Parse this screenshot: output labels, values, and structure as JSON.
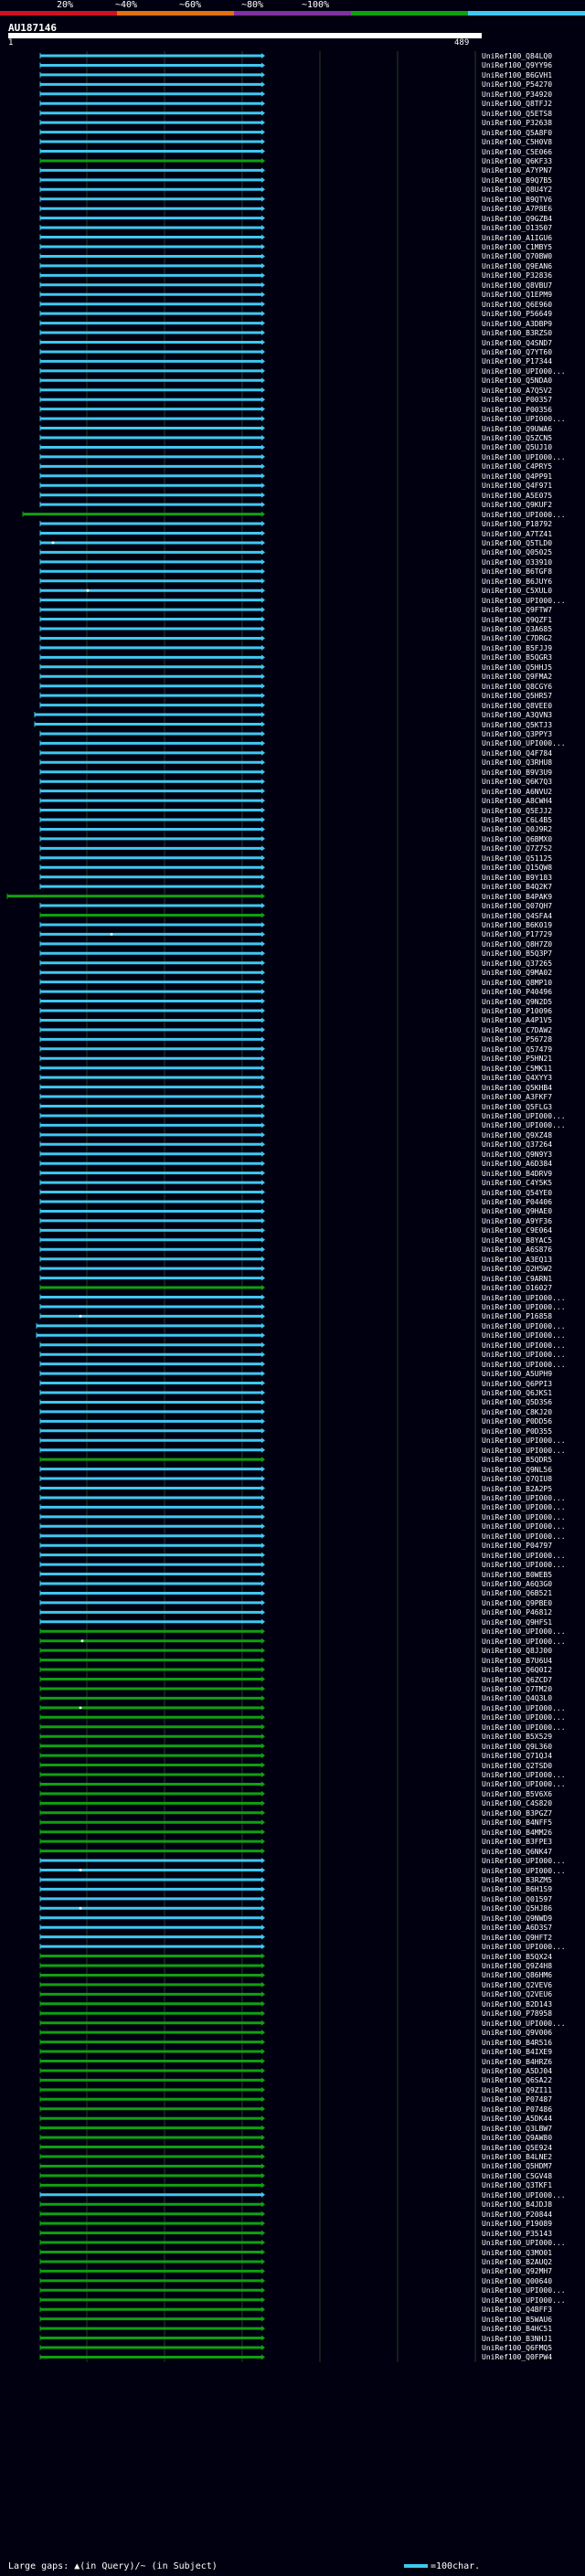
{
  "scale": {
    "segments": [
      {
        "color": "#d01020"
      },
      {
        "color": "#e07010"
      },
      {
        "color": "#8030a0"
      },
      {
        "color": "#10a010"
      },
      {
        "color": "#40c8f0"
      }
    ],
    "labels": [
      "20%",
      "~40%",
      "~60%",
      "~80%",
      "~100%"
    ]
  },
  "query": {
    "id": "AU187146",
    "start": "1",
    "end": "489"
  },
  "colors": {
    "cyan": "#40c8f0",
    "green": "#10a010",
    "grid": "#2a3a2a",
    "gap": "#ffffff"
  },
  "hits": [
    {
      "id": "UniRef100_Q84LQ0",
      "c": "cyan"
    },
    {
      "id": "UniRef100_Q9YY96",
      "c": "cyan"
    },
    {
      "id": "UniRef100_B6GVH1",
      "c": "cyan"
    },
    {
      "id": "UniRef100_P54270",
      "c": "cyan"
    },
    {
      "id": "UniRef100_P34920",
      "c": "cyan"
    },
    {
      "id": "UniRef100_Q8TFJ2",
      "c": "cyan"
    },
    {
      "id": "UniRef100_Q5ETS8",
      "c": "cyan"
    },
    {
      "id": "UniRef100_P32638",
      "c": "cyan"
    },
    {
      "id": "UniRef100_Q5A8F0",
      "c": "cyan"
    },
    {
      "id": "UniRef100_C5H0V8",
      "c": "cyan"
    },
    {
      "id": "UniRef100_C5E066",
      "c": "cyan"
    },
    {
      "id": "UniRef100_Q6KF33",
      "c": "green"
    },
    {
      "id": "UniRef100_A7YPN7",
      "c": "cyan"
    },
    {
      "id": "UniRef100_B9Q7B5",
      "c": "cyan"
    },
    {
      "id": "UniRef100_Q8U4Y2",
      "c": "cyan"
    },
    {
      "id": "UniRef100_B9QTV6",
      "c": "cyan"
    },
    {
      "id": "UniRef100_A7P8E6",
      "c": "cyan"
    },
    {
      "id": "UniRef100_Q9GZB4",
      "c": "cyan"
    },
    {
      "id": "UniRef100_O13507",
      "c": "cyan"
    },
    {
      "id": "UniRef100_A1IGU6",
      "c": "cyan"
    },
    {
      "id": "UniRef100_C1MBY5",
      "c": "cyan"
    },
    {
      "id": "UniRef100_Q70BW0",
      "c": "cyan"
    },
    {
      "id": "UniRef100_Q9EAN6",
      "c": "cyan"
    },
    {
      "id": "UniRef100_P32836",
      "c": "cyan"
    },
    {
      "id": "UniRef100_Q8VBU7",
      "c": "cyan"
    },
    {
      "id": "UniRef100_Q1EPM9",
      "c": "cyan"
    },
    {
      "id": "UniRef100_Q6E960",
      "c": "cyan"
    },
    {
      "id": "UniRef100_P56649",
      "c": "cyan"
    },
    {
      "id": "UniRef100_A3DBP9",
      "c": "cyan"
    },
    {
      "id": "UniRef100_B3RZS0",
      "c": "cyan"
    },
    {
      "id": "UniRef100_Q4SND7",
      "c": "cyan"
    },
    {
      "id": "UniRef100_Q7YT60",
      "c": "cyan"
    },
    {
      "id": "UniRef100_P17344",
      "c": "cyan"
    },
    {
      "id": "UniRef100_UPI000...",
      "c": "cyan"
    },
    {
      "id": "UniRef100_Q5NDA0",
      "c": "cyan"
    },
    {
      "id": "UniRef100_A7Q5V2",
      "c": "cyan"
    },
    {
      "id": "UniRef100_P00357",
      "c": "cyan"
    },
    {
      "id": "UniRef100_P00356",
      "c": "cyan"
    },
    {
      "id": "UniRef100_UPI000...",
      "c": "cyan"
    },
    {
      "id": "UniRef100_Q9UWA6",
      "c": "cyan"
    },
    {
      "id": "UniRef100_Q5ZCN5",
      "c": "cyan"
    },
    {
      "id": "UniRef100_Q5UJ10",
      "c": "cyan"
    },
    {
      "id": "UniRef100_UPI000...",
      "c": "cyan"
    },
    {
      "id": "UniRef100_C4PRY5",
      "c": "cyan"
    },
    {
      "id": "UniRef100_Q4PP91",
      "c": "cyan"
    },
    {
      "id": "UniRef100_Q4F971",
      "c": "cyan"
    },
    {
      "id": "UniRef100_A5E075",
      "c": "cyan"
    },
    {
      "id": "UniRef100_Q9KUF2",
      "c": "cyan"
    },
    {
      "id": "UniRef100_UPI000...",
      "c": "green"
    },
    {
      "id": "UniRef100_P18792",
      "c": "cyan"
    },
    {
      "id": "UniRef100_A7TZ41",
      "c": "cyan"
    },
    {
      "id": "UniRef100_Q5TLD0",
      "c": "cyan"
    },
    {
      "id": "UniRef100_Q05025",
      "c": "cyan"
    },
    {
      "id": "UniRef100_O33910",
      "c": "cyan"
    },
    {
      "id": "UniRef100_B6TGF8",
      "c": "cyan"
    },
    {
      "id": "UniRef100_B6JUY6",
      "c": "cyan"
    },
    {
      "id": "UniRef100_C5XUL0",
      "c": "cyan"
    },
    {
      "id": "UniRef100_UPI000...",
      "c": "cyan"
    },
    {
      "id": "UniRef100_Q9FTW7",
      "c": "cyan"
    },
    {
      "id": "UniRef100_Q9QZF1",
      "c": "cyan"
    },
    {
      "id": "UniRef100_Q3A685",
      "c": "cyan"
    },
    {
      "id": "UniRef100_C7DRG2",
      "c": "cyan"
    },
    {
      "id": "UniRef100_B5FJJ9",
      "c": "cyan"
    },
    {
      "id": "UniRef100_B5QGR3",
      "c": "cyan"
    },
    {
      "id": "UniRef100_Q5HHJ5",
      "c": "cyan"
    },
    {
      "id": "UniRef100_Q9FMA2",
      "c": "cyan"
    },
    {
      "id": "UniRef100_Q8CGY6",
      "c": "cyan"
    },
    {
      "id": "UniRef100_Q5HR57",
      "c": "cyan"
    },
    {
      "id": "UniRef100_Q8VEE0",
      "c": "cyan"
    },
    {
      "id": "UniRef100_A3QVN3",
      "c": "cyan"
    },
    {
      "id": "UniRef100_Q5KTJ3",
      "c": "cyan"
    },
    {
      "id": "UniRef100_Q3PPY3",
      "c": "cyan"
    },
    {
      "id": "UniRef100_UPI000...",
      "c": "cyan"
    },
    {
      "id": "UniRef100_Q4F784",
      "c": "cyan"
    },
    {
      "id": "UniRef100_Q3RHU8",
      "c": "cyan"
    },
    {
      "id": "UniRef100_B9V3U9",
      "c": "cyan"
    },
    {
      "id": "UniRef100_Q6K7Q3",
      "c": "cyan"
    },
    {
      "id": "UniRef100_A6NVU2",
      "c": "cyan"
    },
    {
      "id": "UniRef100_A8CWH4",
      "c": "cyan"
    },
    {
      "id": "UniRef100_Q5EJJ2",
      "c": "cyan"
    },
    {
      "id": "UniRef100_C6L4B5",
      "c": "cyan"
    },
    {
      "id": "UniRef100_Q0J9R2",
      "c": "cyan"
    },
    {
      "id": "UniRef100_Q6BMX0",
      "c": "cyan"
    },
    {
      "id": "UniRef100_Q7Z7S2",
      "c": "cyan"
    },
    {
      "id": "UniRef100_Q51125",
      "c": "cyan"
    },
    {
      "id": "UniRef100_Q15QW8",
      "c": "cyan"
    },
    {
      "id": "UniRef100_B9Y183",
      "c": "cyan"
    },
    {
      "id": "UniRef100_B4Q2K7",
      "c": "cyan"
    },
    {
      "id": "UniRef100_B4PAK9",
      "c": "green"
    },
    {
      "id": "UniRef100_Q07QH7",
      "c": "cyan"
    },
    {
      "id": "UniRef100_Q4SFA4",
      "c": "green"
    },
    {
      "id": "UniRef100_B6K019",
      "c": "cyan"
    },
    {
      "id": "UniRef100_P17729",
      "c": "cyan"
    },
    {
      "id": "UniRef100_Q8H7Z0",
      "c": "cyan"
    },
    {
      "id": "UniRef100_B5Q3P7",
      "c": "cyan"
    },
    {
      "id": "UniRef100_Q37265",
      "c": "cyan"
    },
    {
      "id": "UniRef100_Q9MA02",
      "c": "cyan"
    },
    {
      "id": "UniRef100_Q8MP10",
      "c": "cyan"
    },
    {
      "id": "UniRef100_P40496",
      "c": "cyan"
    },
    {
      "id": "UniRef100_Q9N2D5",
      "c": "cyan"
    },
    {
      "id": "UniRef100_P10096",
      "c": "cyan"
    },
    {
      "id": "UniRef100_A4P1V5",
      "c": "cyan"
    },
    {
      "id": "UniRef100_C7DAW2",
      "c": "cyan"
    },
    {
      "id": "UniRef100_P56728",
      "c": "cyan"
    },
    {
      "id": "UniRef100_Q57479",
      "c": "cyan"
    },
    {
      "id": "UniRef100_P5HN21",
      "c": "cyan"
    },
    {
      "id": "UniRef100_C5MK11",
      "c": "cyan"
    },
    {
      "id": "UniRef100_Q4XYY3",
      "c": "cyan"
    },
    {
      "id": "UniRef100_Q5KHB4",
      "c": "cyan"
    },
    {
      "id": "UniRef100_A3FKF7",
      "c": "cyan"
    },
    {
      "id": "UniRef100_Q5FLG3",
      "c": "cyan"
    },
    {
      "id": "UniRef100_UPI000...",
      "c": "cyan"
    },
    {
      "id": "UniRef100_UPI000...",
      "c": "cyan"
    },
    {
      "id": "UniRef100_Q9XZ48",
      "c": "cyan"
    },
    {
      "id": "UniRef100_Q37264",
      "c": "cyan"
    },
    {
      "id": "UniRef100_Q9N9Y3",
      "c": "cyan"
    },
    {
      "id": "UniRef100_A6D384",
      "c": "cyan"
    },
    {
      "id": "UniRef100_B4DRV9",
      "c": "cyan"
    },
    {
      "id": "UniRef100_C4Y5K5",
      "c": "cyan"
    },
    {
      "id": "UniRef100_Q54YE0",
      "c": "cyan"
    },
    {
      "id": "UniRef100_P04406",
      "c": "cyan"
    },
    {
      "id": "UniRef100_Q9HAE0",
      "c": "cyan"
    },
    {
      "id": "UniRef100_A9YF36",
      "c": "cyan"
    },
    {
      "id": "UniRef100_C9E064",
      "c": "cyan"
    },
    {
      "id": "UniRef100_B8YAC5",
      "c": "cyan"
    },
    {
      "id": "UniRef100_A6S876",
      "c": "cyan"
    },
    {
      "id": "UniRef100_A3EQ13",
      "c": "cyan"
    },
    {
      "id": "UniRef100_Q2H5W2",
      "c": "cyan"
    },
    {
      "id": "UniRef100_C9ARN1",
      "c": "cyan"
    },
    {
      "id": "UniRef100_O16027",
      "c": "green"
    },
    {
      "id": "UniRef100_UPI000...",
      "c": "cyan"
    },
    {
      "id": "UniRef100_UPI000...",
      "c": "cyan"
    },
    {
      "id": "UniRef100_P16858",
      "c": "cyan"
    },
    {
      "id": "UniRef100_UPI000...",
      "c": "cyan"
    },
    {
      "id": "UniRef100_UPI000...",
      "c": "cyan"
    },
    {
      "id": "UniRef100_UPI000...",
      "c": "cyan"
    },
    {
      "id": "UniRef100_UPI000...",
      "c": "cyan"
    },
    {
      "id": "UniRef100_UPI000...",
      "c": "cyan"
    },
    {
      "id": "UniRef100_A5UPH9",
      "c": "cyan"
    },
    {
      "id": "UniRef100_Q6PPI3",
      "c": "cyan"
    },
    {
      "id": "UniRef100_Q6JKS1",
      "c": "cyan"
    },
    {
      "id": "UniRef100_Q5D3S6",
      "c": "cyan"
    },
    {
      "id": "UniRef100_C8KJ20",
      "c": "cyan"
    },
    {
      "id": "UniRef100_P0DD56",
      "c": "cyan"
    },
    {
      "id": "UniRef100_P0D355",
      "c": "cyan"
    },
    {
      "id": "UniRef100_UPI000...",
      "c": "cyan"
    },
    {
      "id": "UniRef100_UPI000...",
      "c": "cyan"
    },
    {
      "id": "UniRef100_B5QDR5",
      "c": "green"
    },
    {
      "id": "UniRef100_Q9NL56",
      "c": "cyan"
    },
    {
      "id": "UniRef100_Q7QIU8",
      "c": "cyan"
    },
    {
      "id": "UniRef100_B2A2P5",
      "c": "cyan"
    },
    {
      "id": "UniRef100_UPI000...",
      "c": "cyan"
    },
    {
      "id": "UniRef100_UPI000...",
      "c": "cyan"
    },
    {
      "id": "UniRef100_UPI000...",
      "c": "cyan"
    },
    {
      "id": "UniRef100_UPI000...",
      "c": "cyan"
    },
    {
      "id": "UniRef100_UPI000...",
      "c": "cyan"
    },
    {
      "id": "UniRef100_P04797",
      "c": "cyan"
    },
    {
      "id": "UniRef100_UPI000...",
      "c": "cyan"
    },
    {
      "id": "UniRef100_UPI000...",
      "c": "cyan"
    },
    {
      "id": "UniRef100_B0WEB5",
      "c": "cyan"
    },
    {
      "id": "UniRef100_A6Q3G0",
      "c": "cyan"
    },
    {
      "id": "UniRef100_Q6B521",
      "c": "cyan"
    },
    {
      "id": "UniRef100_Q9PBE0",
      "c": "cyan"
    },
    {
      "id": "UniRef100_P46812",
      "c": "cyan"
    },
    {
      "id": "UniRef100_Q9HFS1",
      "c": "cyan"
    },
    {
      "id": "UniRef100_UPI000...",
      "c": "green"
    },
    {
      "id": "UniRef100_UPI000...",
      "c": "green"
    },
    {
      "id": "UniRef100_Q8JJ00",
      "c": "green"
    },
    {
      "id": "UniRef100_B7U6U4",
      "c": "green"
    },
    {
      "id": "UniRef100_Q6Q0I2",
      "c": "green"
    },
    {
      "id": "UniRef100_Q6ZCD7",
      "c": "green"
    },
    {
      "id": "UniRef100_Q7TM20",
      "c": "green"
    },
    {
      "id": "UniRef100_Q4Q3L0",
      "c": "green"
    },
    {
      "id": "UniRef100_UPI000...",
      "c": "green"
    },
    {
      "id": "UniRef100_UPI000...",
      "c": "green"
    },
    {
      "id": "UniRef100_UPI000...",
      "c": "green"
    },
    {
      "id": "UniRef100_B5X529",
      "c": "green"
    },
    {
      "id": "UniRef100_Q9L360",
      "c": "green"
    },
    {
      "id": "UniRef100_Q71QJ4",
      "c": "green"
    },
    {
      "id": "UniRef100_Q2TSD0",
      "c": "green"
    },
    {
      "id": "UniRef100_UPI000...",
      "c": "green"
    },
    {
      "id": "UniRef100_UPI000...",
      "c": "green"
    },
    {
      "id": "UniRef100_B5V6X6",
      "c": "green"
    },
    {
      "id": "UniRef100_C4S820",
      "c": "green"
    },
    {
      "id": "UniRef100_B3PGZ7",
      "c": "green"
    },
    {
      "id": "UniRef100_B4NFF5",
      "c": "green"
    },
    {
      "id": "UniRef100_B4MM26",
      "c": "green"
    },
    {
      "id": "UniRef100_B3FPE3",
      "c": "green"
    },
    {
      "id": "UniRef100_Q6NK47",
      "c": "green"
    },
    {
      "id": "UniRef100_UPI000...",
      "c": "cyan"
    },
    {
      "id": "UniRef100_UPI000...",
      "c": "cyan"
    },
    {
      "id": "UniRef100_B3RZM5",
      "c": "cyan"
    },
    {
      "id": "UniRef100_B6H1S9",
      "c": "cyan"
    },
    {
      "id": "UniRef100_Q01597",
      "c": "cyan"
    },
    {
      "id": "UniRef100_Q5HJ86",
      "c": "cyan"
    },
    {
      "id": "UniRef100_Q9NWD9",
      "c": "cyan"
    },
    {
      "id": "UniRef100_A6D3S7",
      "c": "cyan"
    },
    {
      "id": "UniRef100_Q9HFT2",
      "c": "cyan"
    },
    {
      "id": "UniRef100_UPI000...",
      "c": "cyan"
    },
    {
      "id": "UniRef100_B5QX24",
      "c": "green"
    },
    {
      "id": "UniRef100_Q9Z4H8",
      "c": "green"
    },
    {
      "id": "UniRef100_Q86HM6",
      "c": "green"
    },
    {
      "id": "UniRef100_Q2VEV6",
      "c": "green"
    },
    {
      "id": "UniRef100_Q2VEU6",
      "c": "green"
    },
    {
      "id": "UniRef100_B2D143",
      "c": "green"
    },
    {
      "id": "UniRef100_P78958",
      "c": "green"
    },
    {
      "id": "UniRef100_UPI000...",
      "c": "green"
    },
    {
      "id": "UniRef100_Q9V006",
      "c": "green"
    },
    {
      "id": "UniRef100_B4R516",
      "c": "green"
    },
    {
      "id": "UniRef100_B4IXE9",
      "c": "green"
    },
    {
      "id": "UniRef100_B4HRZ6",
      "c": "green"
    },
    {
      "id": "UniRef100_A5DJ04",
      "c": "green"
    },
    {
      "id": "UniRef100_Q6SA22",
      "c": "green"
    },
    {
      "id": "UniRef100_Q9ZI11",
      "c": "green"
    },
    {
      "id": "UniRef100_P07487",
      "c": "green"
    },
    {
      "id": "UniRef100_P07486",
      "c": "green"
    },
    {
      "id": "UniRef100_A5DK44",
      "c": "green"
    },
    {
      "id": "UniRef100_Q3LBW7",
      "c": "green"
    },
    {
      "id": "UniRef100_Q9AW80",
      "c": "green"
    },
    {
      "id": "UniRef100_Q5E924",
      "c": "green"
    },
    {
      "id": "UniRef100_B4LNE2",
      "c": "green"
    },
    {
      "id": "UniRef100_Q5HDM7",
      "c": "green"
    },
    {
      "id": "UniRef100_C5GV48",
      "c": "green"
    },
    {
      "id": "UniRef100_Q3TKF1",
      "c": "green"
    },
    {
      "id": "UniRef100_UPI000...",
      "c": "cyan"
    },
    {
      "id": "UniRef100_B4JDJ8",
      "c": "green"
    },
    {
      "id": "UniRef100_P20844",
      "c": "green"
    },
    {
      "id": "UniRef100_P19089",
      "c": "green"
    },
    {
      "id": "UniRef100_P35143",
      "c": "green"
    },
    {
      "id": "UniRef100_UPI000...",
      "c": "green"
    },
    {
      "id": "UniRef100_Q3MO01",
      "c": "green"
    },
    {
      "id": "UniRef100_B2AUQ2",
      "c": "green"
    },
    {
      "id": "UniRef100_Q92MH7",
      "c": "green"
    },
    {
      "id": "UniRef100_Q00640",
      "c": "green"
    },
    {
      "id": "UniRef100_UPI000...",
      "c": "green"
    },
    {
      "id": "UniRef100_UPI000...",
      "c": "green"
    },
    {
      "id": "UniRef100_Q4BFF3",
      "c": "green"
    },
    {
      "id": "UniRef100_B5WAU6",
      "c": "green"
    },
    {
      "id": "UniRef100_B4HC51",
      "c": "green"
    },
    {
      "id": "UniRef100_B3NHJ1",
      "c": "green"
    },
    {
      "id": "UniRef100_Q6FMQ5",
      "c": "green"
    },
    {
      "id": "UniRef100_Q0FPW4",
      "c": "green"
    }
  ],
  "legend": {
    "left": "Large gaps: ▲(in Query)/~ (in Subject)",
    "right": "=100char."
  }
}
